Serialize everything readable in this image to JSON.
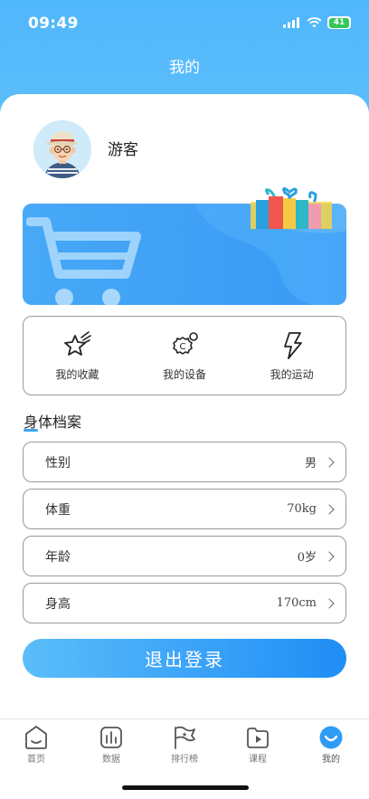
{
  "status_bar": {
    "time": "09:49",
    "battery": "41"
  },
  "header": {
    "title": "我的"
  },
  "profile": {
    "username": "游客"
  },
  "quick_actions": [
    {
      "label": "我的收藏",
      "icon": "star-icon"
    },
    {
      "label": "我的设备",
      "icon": "device-gear-icon"
    },
    {
      "label": "我的运动",
      "icon": "lightning-icon"
    }
  ],
  "body_profile": {
    "title": "身体档案",
    "rows": [
      {
        "label": "性别",
        "value": "男"
      },
      {
        "label": "体重",
        "value": "70kg"
      },
      {
        "label": "年龄",
        "value": "0岁"
      },
      {
        "label": "身高",
        "value": "170cm"
      }
    ]
  },
  "logout_label": "退出登录",
  "tabbar": [
    {
      "label": "首页",
      "icon": "home-icon"
    },
    {
      "label": "数据",
      "icon": "data-bars-icon"
    },
    {
      "label": "排行榜",
      "icon": "flag-icon"
    },
    {
      "label": "课程",
      "icon": "play-icon"
    },
    {
      "label": "我的",
      "icon": "profile-icon",
      "active": true
    }
  ],
  "colors": {
    "primary": "#3DA5F7",
    "header": "#50B7FB"
  }
}
